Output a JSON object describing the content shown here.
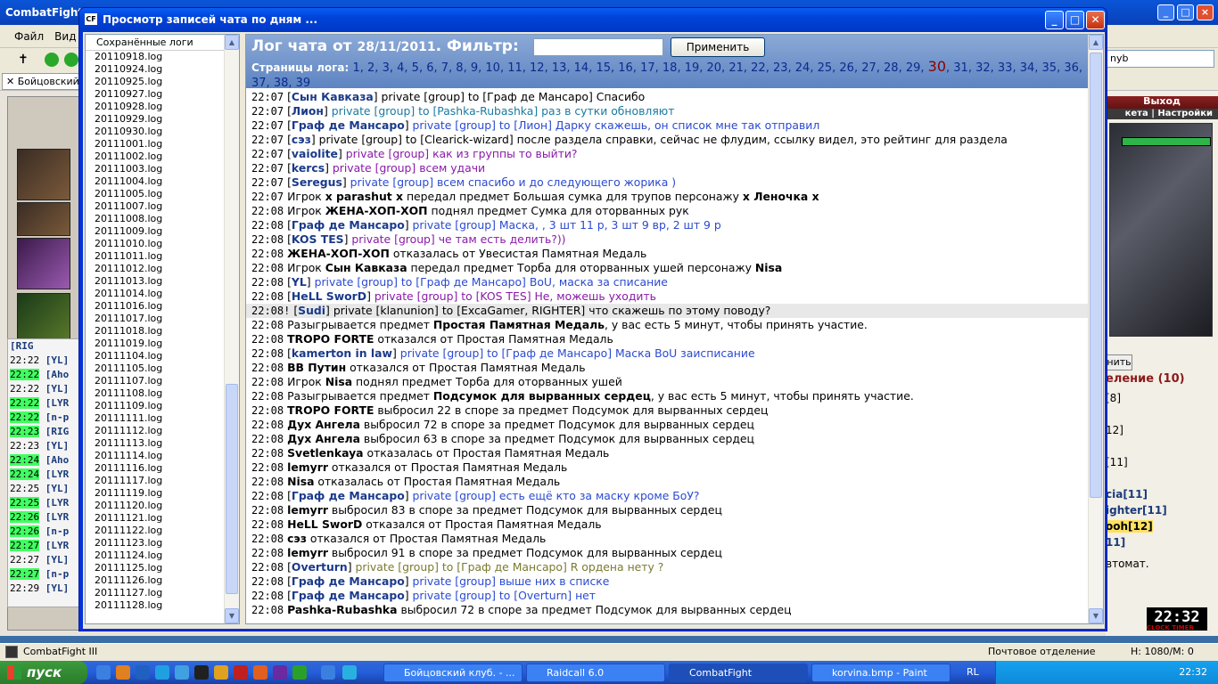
{
  "app": {
    "title": "CombatFight",
    "menu": [
      "Файл",
      "Вид"
    ],
    "tab": "Бойцовский"
  },
  "url_fragment": "nyb",
  "right_panel": {
    "exit": "Выход",
    "sub": "кета | Настройки",
    "online_title": "еление (10)",
    "btn": "нить",
    "auto": "втомат.",
    "names": [
      "[8]",
      "12]",
      "[11]",
      "cia[11]",
      "ighter[11]",
      "ooh[12]",
      "11]"
    ]
  },
  "clock": {
    "time": "22:32",
    "label": "CLOCK TIMER"
  },
  "left_chat": [
    {
      "t": "",
      "n": "[RIG"
    },
    {
      "t": "22:22",
      "n": "[YL]"
    },
    {
      "t": "22:22",
      "n": "[Aho",
      "hl": true
    },
    {
      "t": "22:22",
      "n": "[YL]"
    },
    {
      "t": "22:22",
      "n": "[LYR",
      "hl": true
    },
    {
      "t": "22:22",
      "n": "[n-p",
      "hl": true
    },
    {
      "t": "22:23",
      "n": "[RIG",
      "hl": true
    },
    {
      "t": "22:23",
      "n": "[YL]"
    },
    {
      "t": "22:24",
      "n": "[Aho",
      "hl": true
    },
    {
      "t": "22:24",
      "n": "[LYR",
      "hl": true
    },
    {
      "t": "",
      "n": ""
    },
    {
      "t": "22:25",
      "n": "[YL]"
    },
    {
      "t": "22:25",
      "n": "[LYR",
      "hl": true
    },
    {
      "t": "22:26",
      "n": "[LYR",
      "hl": true
    },
    {
      "t": "22:26",
      "n": "[n-p",
      "hl": true
    },
    {
      "t": "22:27",
      "n": "[LYR",
      "hl": true
    },
    {
      "t": "22:27",
      "n": "[YL]"
    },
    {
      "t": "22:27",
      "n": "[n-p",
      "hl": true
    },
    {
      "t": "22:29",
      "n": "[YL]"
    }
  ],
  "dialog": {
    "title": "Просмотр записей чата по дням ...",
    "list_header": "Сохранённые логи",
    "logs": [
      "20110918.log",
      "20110924.log",
      "20110925.log",
      "20110927.log",
      "20110928.log",
      "20110929.log",
      "20110930.log",
      "20111001.log",
      "20111002.log",
      "20111003.log",
      "20111004.log",
      "20111005.log",
      "20111007.log",
      "20111008.log",
      "20111009.log",
      "20111010.log",
      "20111011.log",
      "20111012.log",
      "20111013.log",
      "20111014.log",
      "20111016.log",
      "20111017.log",
      "20111018.log",
      "20111019.log",
      "20111104.log",
      "20111105.log",
      "20111107.log",
      "20111108.log",
      "20111109.log",
      "20111111.log",
      "20111112.log",
      "20111113.log",
      "20111114.log",
      "20111116.log",
      "20111117.log",
      "20111119.log",
      "20111120.log",
      "20111121.log",
      "20111122.log",
      "20111123.log",
      "20111124.log",
      "20111125.log",
      "20111126.log",
      "20111127.log",
      "20111128.log"
    ],
    "log_title": "Лог чата от",
    "log_date": "28/11/2011",
    "filter_label": ". Фильтр:",
    "apply": "Применить",
    "pages_label": "Страницы лога:",
    "pages": [
      "1",
      "2",
      "3",
      "4",
      "5",
      "6",
      "7",
      "8",
      "9",
      "10",
      "11",
      "12",
      "13",
      "14",
      "15",
      "16",
      "17",
      "18",
      "19",
      "20",
      "21",
      "22",
      "23",
      "24",
      "25",
      "26",
      "27",
      "28",
      "29",
      "30",
      "31",
      "32",
      "33",
      "34",
      "35",
      "36",
      "37",
      "38",
      "39"
    ],
    "current_page": "30",
    "rows": [
      {
        "tm": "22:07",
        "nick": "Сын Кавказа",
        "br": true,
        "pv": "private [group] to [Граф де Мансаро]",
        "msg": " Спасибо",
        "cls": "plain"
      },
      {
        "tm": "22:07",
        "nick": "Лион",
        "br": true,
        "pv": "private [group] to [Pashka-Rubashka] раз в сутки обновляют",
        "msg": "",
        "cls": "teal"
      },
      {
        "tm": "22:07",
        "nick": "Граф де Мансаро",
        "br": true,
        "pv": "private [group] to [Лион] Дарку скажешь, он список мне так отправил",
        "msg": "",
        "cls": ""
      },
      {
        "tm": "22:07",
        "nick": "сэз",
        "br": true,
        "pv": "private [group] to [Clearick-wizard] после раздела справки, сейчас не флудим, ссылку видел, это рейтинг для раздела",
        "msg": "",
        "cls": "plain"
      },
      {
        "tm": "22:07",
        "nick": "vaiolite",
        "br": true,
        "pv": "private [group] как из группы то выйти?",
        "msg": "",
        "cls": "purple"
      },
      {
        "tm": "22:07",
        "nick": "kercs",
        "br": true,
        "pv": "private [group] всем удачи",
        "msg": "",
        "cls": "purple"
      },
      {
        "tm": "22:07",
        "nick": "Seregus",
        "br": true,
        "pv": "private [group] всем спасибо и до следующего жорика )",
        "msg": "",
        "cls": ""
      },
      {
        "tm": "22:07",
        "text": "Игрок <b>x parashut x</b> передал предмет Большая сумка для трупов персонажу <b>x Леночка x</b>"
      },
      {
        "tm": "22:08",
        "text": "Игрок <b>ЖЕНА-ХОП-ХОП</b> поднял предмет Сумка для оторванных рук"
      },
      {
        "tm": "22:08",
        "nick": "Граф де Мансаро",
        "br": true,
        "pv": "private [group] Маска, , 3 шт 11 р, 3 шт 9 вр, 2 шт 9 р",
        "msg": "",
        "cls": ""
      },
      {
        "tm": "22:08",
        "nick": "KOS TES",
        "br": true,
        "pv": "private [group] че там есть делить?))",
        "msg": "",
        "cls": "purple"
      },
      {
        "tm": "22:08",
        "text": "<b>ЖЕНА-ХОП-ХОП</b> отказалась от Увесистая Памятная Медаль"
      },
      {
        "tm": "22:08",
        "text": "Игрок <b>Сын Кавказа</b> передал предмет Торба для оторванных ушей персонажу <b>Nisa</b>"
      },
      {
        "tm": "22:08",
        "nick": "YL",
        "br": true,
        "pv": "private [group] to [Граф де Мансаро] BoU, маска за списание",
        "msg": "",
        "cls": ""
      },
      {
        "tm": "22:08",
        "nick": "HeLL SworD",
        "br": true,
        "pv": "private [group] to [KOS TES] Не, можешь уходить",
        "msg": "",
        "cls": "purple"
      },
      {
        "tm": "22:08!",
        "nick": "Sudi",
        "br": true,
        "pv": "private [klanunion] to [ExcaGamer, RIGHTER] что скажешь по этому поводу?",
        "msg": "",
        "cls": "plain",
        "hi": true
      },
      {
        "tm": "22:08",
        "text": "Разыгрывается предмет <b>Простая Памятная Медаль</b>, у вас есть 5 минут, чтобы принять участие."
      },
      {
        "tm": "22:08",
        "text": "<b>TROPO FORTE</b> отказался от Простая Памятная Медаль"
      },
      {
        "tm": "22:08",
        "nick": "kamerton in law",
        "br": true,
        "pv": "private [group] to [Граф де Мансаро] Маска BoU заисписание",
        "msg": "",
        "cls": ""
      },
      {
        "tm": "22:08",
        "text": "<b>BB Путин</b> отказался от Простая Памятная Медаль"
      },
      {
        "tm": "22:08",
        "text": "Игрок <b>Nisa</b> поднял предмет Торба для оторванных ушей"
      },
      {
        "tm": "22:08",
        "text": "Разыгрывается предмет <b>Подсумок для вырванных сердец</b>, у вас есть 5 минут, чтобы принять участие."
      },
      {
        "tm": "22:08",
        "text": "<b>TROPO FORTE</b> выбросил 22 в споре за предмет Подсумок для вырванных сердец"
      },
      {
        "tm": "22:08",
        "text": "<b>Дух Ангела</b> выбросил 72 в споре за предмет Подсумок для вырванных сердец"
      },
      {
        "tm": "22:08",
        "text": "<b>Дух Ангела</b> выбросил 63 в споре за предмет Подсумок для вырванных сердец"
      },
      {
        "tm": "22:08",
        "text": "<b>Svetlenkaya</b> отказалась от Простая Памятная Медаль"
      },
      {
        "tm": "22:08",
        "text": "<b>lemyrr</b> отказался от Простая Памятная Медаль"
      },
      {
        "tm": "22:08",
        "text": "<b>Nisa</b> отказалась от Простая Памятная Медаль"
      },
      {
        "tm": "22:08",
        "nick": "Граф де Мансаро",
        "br": true,
        "pv": "private [group] есть ещё кто за маску кроме БоУ?",
        "msg": "",
        "cls": ""
      },
      {
        "tm": "22:08",
        "text": "<b>lemyrr</b> выбросил 83 в споре за предмет Подсумок для вырванных сердец"
      },
      {
        "tm": "22:08",
        "text": "<b>HeLL SworD</b> отказался от Простая Памятная Медаль"
      },
      {
        "tm": "22:08",
        "text": "<b>сэз</b> отказался от Простая Памятная Медаль"
      },
      {
        "tm": "22:08",
        "text": "<b>lemyrr</b> выбросил 91 в споре за предмет Подсумок для вырванных сердец"
      },
      {
        "tm": "22:08",
        "nick": "Overturn",
        "br": true,
        "pv": "private [group] to [Граф де Мансаро] R ордена нету ?",
        "msg": "",
        "cls": "olive"
      },
      {
        "tm": "22:08",
        "nick": "Граф де Мансаро",
        "br": true,
        "pv": "private [group] выше них в списке",
        "msg": "",
        "cls": ""
      },
      {
        "tm": "22:08",
        "nick": "Граф де Мансаро",
        "br": true,
        "pv": "private [group] to [Overturn] нет",
        "msg": "",
        "cls": ""
      },
      {
        "tm": "22:08",
        "text": "<b>Pashka-Rubashka</b> выбросил 72 в споре за предмет Подсумок для вырванных сердец"
      }
    ]
  },
  "statusbar": {
    "left": "CombatFight III",
    "mail": "Почтовое отделение",
    "counter": "H: 1080/M: 0"
  },
  "taskbar": {
    "start": "пуск",
    "tasks": [
      "Бойцовский клуб. - ...",
      "Raidcall 6.0",
      "CombatFight",
      "korvina.bmp - Paint"
    ],
    "lang": "RL",
    "time": "22:32"
  }
}
